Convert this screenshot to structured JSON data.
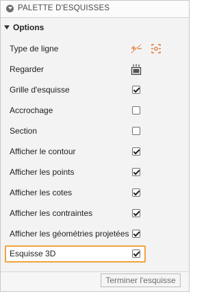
{
  "panel": {
    "title": "PALETTE D'ESQUISSES"
  },
  "section": {
    "title": "Options"
  },
  "rows": [
    {
      "label": "Type de ligne"
    },
    {
      "label": "Regarder"
    },
    {
      "label": "Grille d'esquisse",
      "checked": true
    },
    {
      "label": "Accrochage",
      "checked": false
    },
    {
      "label": "Section",
      "checked": false
    },
    {
      "label": "Afficher le contour",
      "checked": true
    },
    {
      "label": "Afficher les points",
      "checked": true
    },
    {
      "label": "Afficher les cotes",
      "checked": true
    },
    {
      "label": "Afficher les contraintes",
      "checked": true
    },
    {
      "label": "Afficher les géométries projetées",
      "checked": true
    },
    {
      "label": "Esquisse 3D",
      "checked": true
    }
  ],
  "footer": {
    "finish_label": "Terminer l'esquisse"
  },
  "icons": {
    "linetype_normal": "line-type-normal-icon",
    "linetype_construction": "line-type-construction-icon",
    "look": "look-at-icon"
  },
  "colors": {
    "highlight": "#f0a33b",
    "accent": "#e06a1f"
  }
}
